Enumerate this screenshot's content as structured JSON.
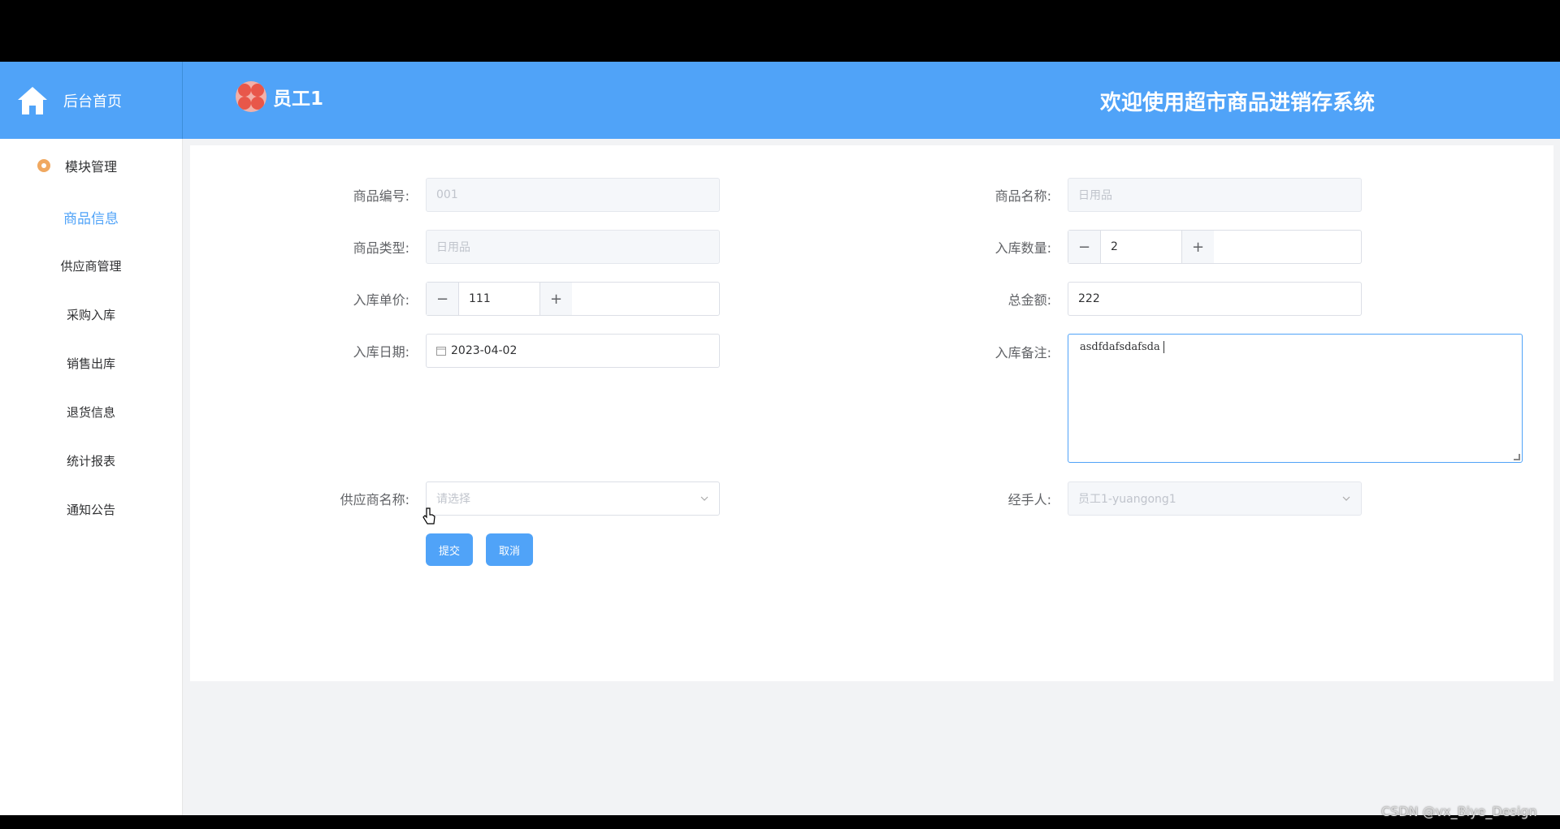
{
  "header": {
    "home_label": "后台首页",
    "user_name": "员工1",
    "welcome": "欢迎使用超市商品进销存系统"
  },
  "sidebar": {
    "group_label": "模块管理",
    "items": [
      {
        "label": "商品信息",
        "active": true
      },
      {
        "label": "供应商管理"
      },
      {
        "label": "采购入库"
      },
      {
        "label": "销售出库"
      },
      {
        "label": "退货信息"
      },
      {
        "label": "统计报表"
      },
      {
        "label": "通知公告"
      }
    ]
  },
  "form": {
    "code_label": "商品编号:",
    "code_value": "001",
    "name_label": "商品名称:",
    "name_value": "日用品",
    "type_label": "商品类型:",
    "type_value": "日用品",
    "qty_label": "入库数量:",
    "qty_value": "2",
    "price_label": "入库单价:",
    "price_value": "111",
    "total_label": "总金额:",
    "total_value": "222",
    "date_label": "入库日期:",
    "date_value": "2023-04-02",
    "remark_label": "入库备注:",
    "remark_value": "asdfdafsdafsda",
    "supplier_label": "供应商名称:",
    "supplier_placeholder": "请选择",
    "handler_label": "经手人:",
    "handler_value": "员工1-yuangong1",
    "submit_label": "提交",
    "cancel_label": "取消"
  },
  "watermark": "CSDN @vx_Biye_Design",
  "colors": {
    "accent": "#50a3f8",
    "header_bg": "#50a3f8",
    "page_bg": "#f2f3f5"
  }
}
